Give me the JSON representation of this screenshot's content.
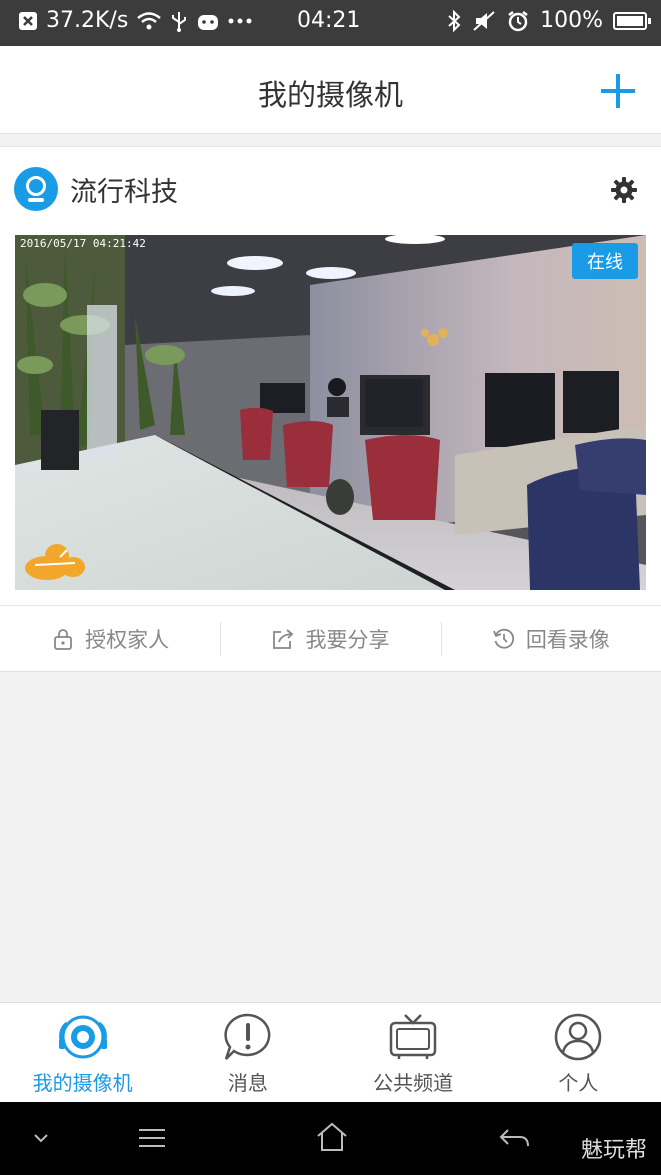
{
  "status_bar": {
    "speed": "37.2K/s",
    "time": "04:21",
    "battery": "100%"
  },
  "header": {
    "title": "我的摄像机"
  },
  "camera": {
    "name": "流行科技",
    "timestamp": "2016/05/17  04:21:42",
    "status": "在线"
  },
  "actions": [
    {
      "label": "授权家人",
      "icon": "lock-icon"
    },
    {
      "label": "我要分享",
      "icon": "share-icon"
    },
    {
      "label": "回看录像",
      "icon": "history-icon"
    }
  ],
  "tabs": [
    {
      "label": "我的摄像机",
      "icon": "camera-icon",
      "active": true
    },
    {
      "label": "消息",
      "icon": "message-icon",
      "active": false
    },
    {
      "label": "公共频道",
      "icon": "tv-icon",
      "active": false
    },
    {
      "label": "个人",
      "icon": "person-icon",
      "active": false
    }
  ],
  "watermark": "魅玩帮",
  "colors": {
    "accent": "#1a9be6",
    "status_bar": "#3c3c3c",
    "background": "#f2f2f2"
  }
}
